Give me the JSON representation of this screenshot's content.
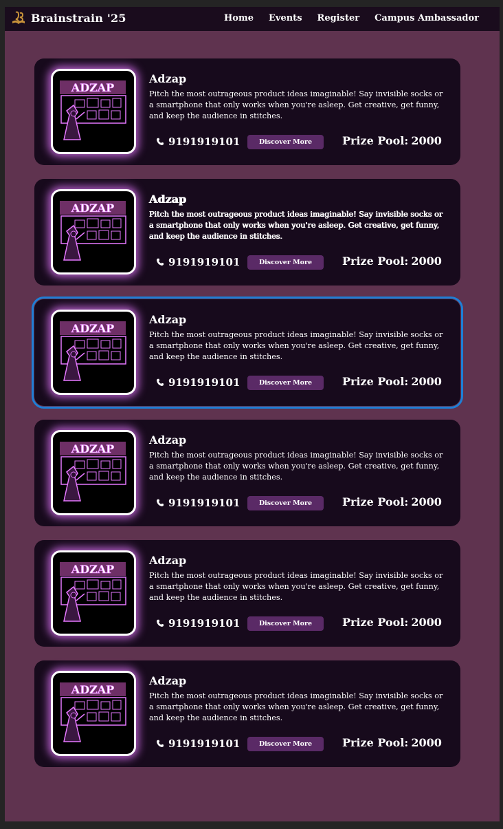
{
  "navbar": {
    "brand": "Brainstrain '25",
    "links": [
      "Home",
      "Events",
      "Register",
      "Campus Ambassador"
    ]
  },
  "events": [
    {
      "poster": "ADZAP",
      "title": "Adzap",
      "description": "Pitch the most outrageous product ideas imaginable! Say invisible socks or a smartphone that only works when you're asleep. Get creative, get funny, and keep the audience in stitches.",
      "phone": "9191919101",
      "button": "Discover More",
      "prize_label": "Prize Pool:",
      "prize_value": "2000"
    },
    {
      "poster": "ADZAP",
      "title": "Adzap",
      "description": "Pitch the most outrageous product ideas imaginable! Say invisible socks or a smartphone that only works when you're asleep. Get creative, get funny, and keep the audience in stitches.",
      "phone": "9191919101",
      "button": "Discover More",
      "prize_label": "Prize Pool:",
      "prize_value": "2000"
    },
    {
      "poster": "ADZAP",
      "title": "Adzap",
      "description": "Pitch the most outrageous product ideas imaginable! Say invisible socks or a smartphone that only works when you're asleep. Get creative, get funny, and keep the audience in stitches.",
      "phone": "9191919101",
      "button": "Discover More",
      "prize_label": "Prize Pool:",
      "prize_value": "2000"
    },
    {
      "poster": "ADZAP",
      "title": "Adzap",
      "description": "Pitch the most outrageous product ideas imaginable! Say invisible socks or a smartphone that only works when you're asleep. Get creative, get funny, and keep the audience in stitches.",
      "phone": "9191919101",
      "button": "Discover More",
      "prize_label": "Prize Pool:",
      "prize_value": "2000"
    },
    {
      "poster": "ADZAP",
      "title": "Adzap",
      "description": "Pitch the most outrageous product ideas imaginable! Say invisible socks or a smartphone that only works when you're asleep. Get creative, get funny, and keep the audience in stitches.",
      "phone": "9191919101",
      "button": "Discover More",
      "prize_label": "Prize Pool:",
      "prize_value": "2000"
    },
    {
      "poster": "ADZAP",
      "title": "Adzap",
      "description": "Pitch the most outrageous product ideas imaginable! Say invisible socks or a smartphone that only works when you're asleep. Get creative, get funny, and keep the audience in stitches.",
      "phone": "9191919101",
      "button": "Discover More",
      "prize_label": "Prize Pool:",
      "prize_value": "2000"
    }
  ],
  "icons": {
    "brand": "book-logo-icon",
    "phone": "phone-icon",
    "poster": "wizard-pitch-board-icon"
  },
  "colors": {
    "page_bg": "#5f334f",
    "navbar_bg": "#1a0c1d",
    "card_bg": "#170a1c",
    "button_bg": "#5a2a66",
    "glow": "#e678ff",
    "focus_outline": "#1e7fd6"
  }
}
